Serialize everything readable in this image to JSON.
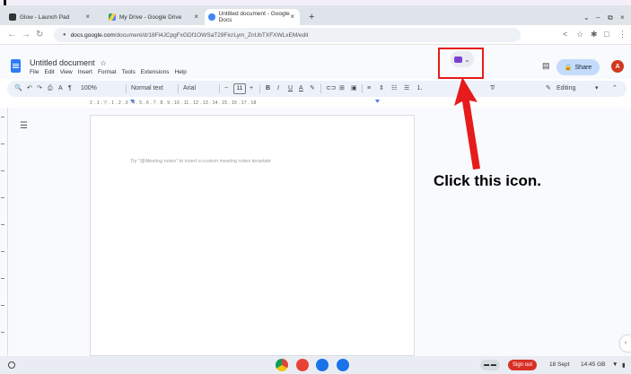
{
  "browser": {
    "tabs": [
      {
        "title": "Glow - Launch Pad",
        "close": "×"
      },
      {
        "title": "My Drive - Google Drive",
        "close": "×"
      },
      {
        "title": "Untitled document - Google Docs",
        "close": "×"
      }
    ],
    "new_tab": "+",
    "window_controls": {
      "minimize": "⌄",
      "restore": "–",
      "maximize": "⧉",
      "close": "×"
    },
    "nav": {
      "back": "←",
      "forward": "→",
      "reload": "↻"
    },
    "url_host": "docs.google.com",
    "url_path": "/document/d/18Fl4JCpgFxGDf1OWSaT29FicrLym_ZnUbTXFXWLxEM/edit",
    "address_icons": [
      "<",
      "☆",
      "✱",
      "□",
      "⋮"
    ]
  },
  "docs": {
    "title": "Untitled document",
    "star": "☆",
    "menu": [
      "File",
      "Edit",
      "View",
      "Insert",
      "Format",
      "Tools",
      "Extensions",
      "Help"
    ],
    "meet_chevron": "⌄",
    "comment_icon": "▤",
    "share_label": "Share",
    "share_icon": "🔒",
    "avatar_letter": "A",
    "toolbar": {
      "search": "🔍",
      "undo": "↶",
      "redo": "↷",
      "print": "⎙",
      "spellcheck": "A",
      "paint_format": "¶",
      "zoom": "100%",
      "style": "Normal text",
      "font": "Arial",
      "font_size": "11",
      "minus": "−",
      "plus": "+",
      "bold": "B",
      "italic": "I",
      "underline": "U",
      "text_color": "A",
      "highlight": "✎",
      "link": "⊂⊃",
      "comment": "⊞",
      "image": "▣",
      "align": "≡",
      "line_spacing": "⇕",
      "checklist": "☷",
      "bullets": "☰",
      "numbered": "⒈",
      "clear_format": "T̸",
      "mode": "Editing",
      "collapse": "⌃"
    },
    "ruler_numbers": "2 . 1 . ▽ . 1 . 2 . 3 . 4 . 5 . 6 . 7 . 8 . 9 . 10 . 11 . 12 . 13 . 14 . 15 . 16 . 17 . 18",
    "hint": "Try \"@Meeting notes\" to insert a custom meeting notes template",
    "outline_icon": "☰",
    "side_chevron": "‹"
  },
  "annotation": {
    "instruction": "Click this icon.",
    "highlight_color": "#e61b1b",
    "arrow_color": "#e61b1b"
  },
  "shelf": {
    "sign_out": "Sign out",
    "date": "18 Sept",
    "time": "14:45 GB",
    "apps": [
      "chrome-icon",
      "photos-icon",
      "meet-icon",
      "files-icon"
    ]
  }
}
